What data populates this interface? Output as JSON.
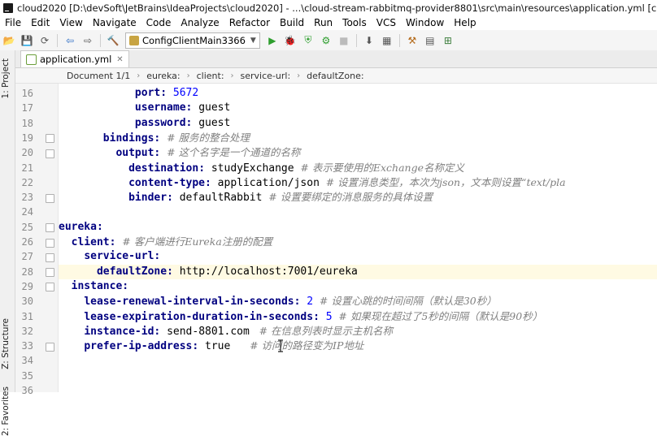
{
  "window": {
    "title": "cloud2020 [D:\\devSoft\\JetBrains\\IdeaProjects\\cloud2020] - ...\\cloud-stream-rabbitmq-provider8801\\src\\main\\resources\\application.yml [cloud-stream-rabbitmq-p"
  },
  "menu": [
    "File",
    "Edit",
    "View",
    "Navigate",
    "Code",
    "Analyze",
    "Refactor",
    "Build",
    "Run",
    "Tools",
    "VCS",
    "Window",
    "Help"
  ],
  "toolbar": {
    "run_config": "ConfigClientMain3366"
  },
  "side_tabs": {
    "project": "1: Project",
    "structure": "Z: Structure",
    "favorites": "2: Favorites"
  },
  "tab": {
    "label": "application.yml"
  },
  "breadcrumb": [
    "Document 1/1",
    "eureka:",
    "client:",
    "service-url:",
    "defaultZone:"
  ],
  "editor": {
    "lines": [
      {
        "num": "16",
        "indent": "            ",
        "key": "port",
        "value": "5672",
        "comment": ""
      },
      {
        "num": "17",
        "indent": "            ",
        "key": "username",
        "value": "guest",
        "comment": ""
      },
      {
        "num": "18",
        "indent": "            ",
        "key": "password",
        "value": "guest",
        "comment": ""
      },
      {
        "num": "19",
        "indent": "       ",
        "key": "bindings",
        "value": "",
        "comment": "# 服务的整合处理"
      },
      {
        "num": "20",
        "indent": "         ",
        "key": "output",
        "value": "",
        "comment": "# 这个名字是一个通道的名称"
      },
      {
        "num": "21",
        "indent": "           ",
        "key": "destination",
        "value": "studyExchange",
        "comment": "# 表示要使用的Exchange名称定义"
      },
      {
        "num": "22",
        "indent": "           ",
        "key": "content-type",
        "value": "application/json",
        "comment": "# 设置消息类型，本次为json，文本则设置“text/pla"
      },
      {
        "num": "23",
        "indent": "           ",
        "key": "binder",
        "value": "defaultRabbit",
        "comment": "# 设置要绑定的消息服务的具体设置"
      },
      {
        "num": "24",
        "indent": "",
        "key": "",
        "value": "",
        "comment": ""
      },
      {
        "num": "25",
        "indent": "",
        "key": "eureka",
        "value": "",
        "comment": ""
      },
      {
        "num": "26",
        "indent": "  ",
        "key": "client",
        "value": "",
        "comment": "# 客户端进行Eureka注册的配置"
      },
      {
        "num": "27",
        "indent": "    ",
        "key": "service-url",
        "value": "",
        "comment": ""
      },
      {
        "num": "28",
        "indent": "      ",
        "key": "defaultZone",
        "value": "http://localhost:7001/eureka",
        "comment": ""
      },
      {
        "num": "29",
        "indent": "  ",
        "key": "instance",
        "value": "",
        "comment": ""
      },
      {
        "num": "30",
        "indent": "    ",
        "key": "lease-renewal-interval-in-seconds",
        "value": "2",
        "comment": "# 设置心跳的时间间隔（默认是30秒）"
      },
      {
        "num": "31",
        "indent": "    ",
        "key": "lease-expiration-duration-in-seconds",
        "value": "5",
        "comment": "# 如果现在超过了5秒的间隔（默认是90秒）"
      },
      {
        "num": "32",
        "indent": "    ",
        "key": "instance-id",
        "value": "send-8801.com",
        "comment": " # 在信息列表时显示主机名称"
      },
      {
        "num": "33",
        "indent": "    ",
        "key": "prefer-ip-address",
        "value": "true",
        "comment": "    # 访问的路径变为IP地址"
      },
      {
        "num": "34",
        "indent": "",
        "key": "",
        "value": "",
        "comment": ""
      },
      {
        "num": "35",
        "indent": "",
        "key": "",
        "value": "",
        "comment": ""
      },
      {
        "num": "36",
        "indent": "",
        "key": "",
        "value": "",
        "comment": ""
      }
    ]
  },
  "colors": {
    "key": "#000080",
    "number": "#0000ff",
    "comment": "#808080",
    "current_line": "#fffae3"
  }
}
